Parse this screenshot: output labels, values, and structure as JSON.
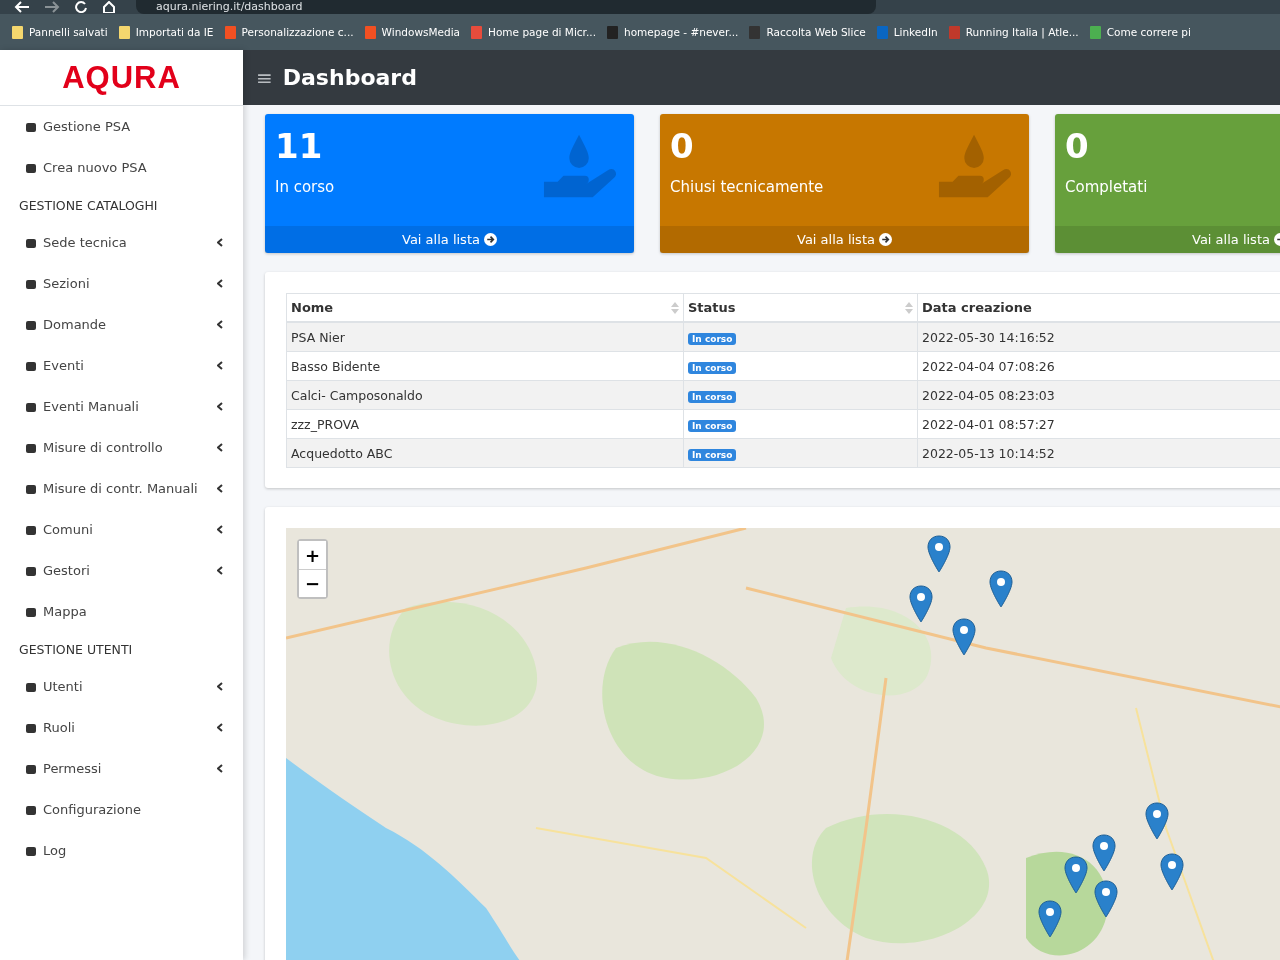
{
  "browser": {
    "address": "aqura.niering.it/dashboard",
    "bookmarks": [
      "Pannelli salvati",
      "Importati da IE",
      "Personalizzazione c...",
      "WindowsMedia",
      "Home page di Micr...",
      "homepage - #never...",
      "Raccolta Web Slice",
      "LinkedIn",
      "Running Italia | Atle...",
      "Come correre pi"
    ]
  },
  "logo": "AQURA",
  "header": {
    "title": "Dashboard",
    "menu_glyph": "≡"
  },
  "sidebar": {
    "items": [
      {
        "kind": "item",
        "label": "Gestione PSA",
        "expandable": false
      },
      {
        "kind": "item",
        "label": "Crea nuovo PSA",
        "expandable": false
      },
      {
        "kind": "heading",
        "label": "GESTIONE CATALOGHI"
      },
      {
        "kind": "item",
        "label": "Sede tecnica",
        "expandable": true
      },
      {
        "kind": "item",
        "label": "Sezioni",
        "expandable": true
      },
      {
        "kind": "item",
        "label": "Domande",
        "expandable": true
      },
      {
        "kind": "item",
        "label": "Eventi",
        "expandable": true
      },
      {
        "kind": "item",
        "label": "Eventi Manuali",
        "expandable": true
      },
      {
        "kind": "item",
        "label": "Misure di controllo",
        "expandable": true
      },
      {
        "kind": "item",
        "label": "Misure di contr. Manuali",
        "expandable": true
      },
      {
        "kind": "item",
        "label": "Comuni",
        "expandable": true
      },
      {
        "kind": "item",
        "label": "Gestori",
        "expandable": true
      },
      {
        "kind": "item",
        "label": "Mappa",
        "expandable": false
      },
      {
        "kind": "heading",
        "label": "GESTIONE UTENTI"
      },
      {
        "kind": "item",
        "label": "Utenti",
        "expandable": true
      },
      {
        "kind": "item",
        "label": "Ruoli",
        "expandable": true
      },
      {
        "kind": "item",
        "label": "Permessi",
        "expandable": true
      },
      {
        "kind": "item",
        "label": "Configurazione",
        "expandable": false
      },
      {
        "kind": "item",
        "label": "Log",
        "expandable": false
      }
    ]
  },
  "stat_cards": [
    {
      "count": "11",
      "label": "In corso",
      "link": "Vai alla lista",
      "color": "#007bff"
    },
    {
      "count": "0",
      "label": "Chiusi tecnicamente",
      "link": "Vai alla lista",
      "color": "#c77700"
    },
    {
      "count": "0",
      "label": "Completati",
      "link": "Vai alla lista",
      "color": "#67a03c"
    }
  ],
  "table": {
    "columns": [
      "Nome",
      "Status",
      "Data creazione"
    ],
    "rows": [
      {
        "name": "PSA Nier",
        "status": "In corso",
        "created": "2022-05-30 14:16:52"
      },
      {
        "name": "Basso Bidente",
        "status": "In corso",
        "created": "2022-04-04 07:08:26"
      },
      {
        "name": "Calci- Camposonaldo",
        "status": "In corso",
        "created": "2022-04-05 08:23:03"
      },
      {
        "name": "zzz_PROVA",
        "status": "In corso",
        "created": "2022-04-01 08:57:27"
      },
      {
        "name": "Acquedotto ABC",
        "status": "In corso",
        "created": "2022-05-13 10:14:52"
      }
    ]
  },
  "map": {
    "kind": "picture",
    "zoom_in": "+",
    "zoom_out": "−"
  }
}
